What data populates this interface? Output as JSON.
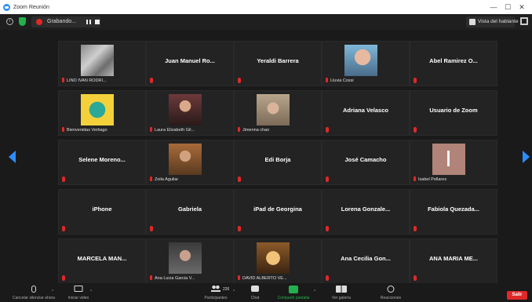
{
  "window": {
    "title": "Zoom Reunión",
    "controls": [
      "—",
      "☐",
      "✕"
    ]
  },
  "topbar": {
    "recording_label": "Grabando...",
    "speaker_view_label": "Vista del hablante"
  },
  "nav": {
    "left_page": "",
    "right_page": ""
  },
  "tiles": [
    {
      "name": "LINO IVAN RODRI...",
      "video": "gray",
      "caption": true
    },
    {
      "name": "Juan Manuel Ro...",
      "video": null
    },
    {
      "name": "Yeraldi Barrera",
      "video": null
    },
    {
      "name": "Lluvia Cossi",
      "video": "girl",
      "caption": true
    },
    {
      "name": "Abel Ramirez O...",
      "video": null
    },
    {
      "name": "Bienvenidas Vertiago",
      "video": "cartoon",
      "caption": true
    },
    {
      "name": "Laura Elizabeth Gil...",
      "video": "woman1",
      "caption": true
    },
    {
      "name": "Jimenna chao",
      "video": "woman2",
      "caption": true
    },
    {
      "name": "Adriana Velasco",
      "video": null
    },
    {
      "name": "Usuario de Zoom",
      "video": null
    },
    {
      "name": "Selene Moreno...",
      "video": null
    },
    {
      "name": "Zoila Aguilar",
      "video": "woman3",
      "caption": true
    },
    {
      "name": "Edi Borja",
      "video": null
    },
    {
      "name": "José Camacho",
      "video": null
    },
    {
      "name": "Isabel Pellares",
      "video": "isabel",
      "caption": true
    },
    {
      "name": "iPhone",
      "video": null
    },
    {
      "name": "Gabriela",
      "video": null
    },
    {
      "name": "iPad de Georgina",
      "video": null
    },
    {
      "name": "Lorena Gonzale...",
      "video": null
    },
    {
      "name": "Fabiola Quezada...",
      "video": null
    },
    {
      "name": "MARCELA MAN...",
      "video": null
    },
    {
      "name": "Ana Lucia Garcia V...",
      "video": "ana",
      "caption": true
    },
    {
      "name": "DAVID ALBERTO VE...",
      "video": "david",
      "caption": true
    },
    {
      "name": "Ana Cecilia Gon...",
      "video": null
    },
    {
      "name": "ANA MARIA ME...",
      "video": null
    }
  ],
  "toolbar": {
    "unmute_label": "Cancelar silenciar ahora",
    "video_label": "Iniciar video",
    "participants_label": "Participantes",
    "participants_count": "226",
    "chat_label": "Chat",
    "share_label": "Compartir pantalla",
    "gallery_label": "Ver galería",
    "reactions_label": "Reacciones",
    "leave_label": "Salir"
  },
  "colors": {
    "accent": "#2d8cff",
    "mute": "#e02828",
    "share": "#23b14d"
  }
}
